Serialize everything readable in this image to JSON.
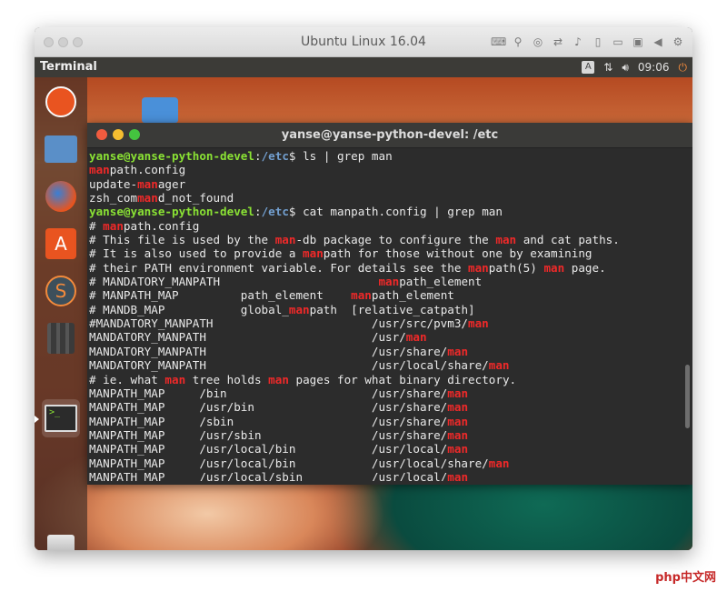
{
  "vm": {
    "title": "Ubuntu Linux 16.04",
    "toolbar_icons": [
      "keyboard-icon",
      "usb-icon",
      "disc-icon",
      "network-icon",
      "audio-icon",
      "phone-icon",
      "folder-icon",
      "display-icon",
      "back-icon",
      "gear-icon"
    ]
  },
  "panel": {
    "app_title": "Terminal",
    "keyboard_indicator": "A",
    "time": "09:06"
  },
  "launcher": {
    "items": [
      "ubuntu-dash-icon",
      "files-icon",
      "firefox-icon",
      "software-center-icon",
      "sublime-text-icon",
      "settings-icon",
      "terminal-icon",
      "trash-icon"
    ]
  },
  "terminal": {
    "title": "yanse@yanse-python-devel: /etc",
    "lines": [
      [
        [
          "user",
          "yanse@yanse-python-devel"
        ],
        [
          "text",
          ":"
        ],
        [
          "path",
          "/etc"
        ],
        [
          "text",
          "$ ls | grep man"
        ]
      ],
      [
        [
          "hl",
          "man"
        ],
        [
          "text",
          "path.config"
        ]
      ],
      [
        [
          "text",
          "update-"
        ],
        [
          "hl",
          "man"
        ],
        [
          "text",
          "ager"
        ]
      ],
      [
        [
          "text",
          "zsh_com"
        ],
        [
          "hl",
          "man"
        ],
        [
          "text",
          "d_not_found"
        ]
      ],
      [
        [
          "user",
          "yanse@yanse-python-devel"
        ],
        [
          "text",
          ":"
        ],
        [
          "path",
          "/etc"
        ],
        [
          "text",
          "$ cat manpath.config | grep man"
        ]
      ],
      [
        [
          "text",
          "# "
        ],
        [
          "hl",
          "man"
        ],
        [
          "text",
          "path.config"
        ]
      ],
      [
        [
          "text",
          "# This file is used by the "
        ],
        [
          "hl",
          "man"
        ],
        [
          "text",
          "-db package to configure the "
        ],
        [
          "hl",
          "man"
        ],
        [
          "text",
          " and cat paths."
        ]
      ],
      [
        [
          "text",
          "# It is also used to provide a "
        ],
        [
          "hl",
          "man"
        ],
        [
          "text",
          "path for those without one by examining"
        ]
      ],
      [
        [
          "text",
          "# their PATH environment variable. For details see the "
        ],
        [
          "hl",
          "man"
        ],
        [
          "text",
          "path(5) "
        ],
        [
          "hl",
          "man"
        ],
        [
          "text",
          " page."
        ]
      ],
      [
        [
          "text",
          "# MANDATORY_MANPATH                       "
        ],
        [
          "hl",
          "man"
        ],
        [
          "text",
          "path_element"
        ]
      ],
      [
        [
          "text",
          "# MANPATH_MAP         path_element    "
        ],
        [
          "hl",
          "man"
        ],
        [
          "text",
          "path_element"
        ]
      ],
      [
        [
          "text",
          "# MANDB_MAP           global_"
        ],
        [
          "hl",
          "man"
        ],
        [
          "text",
          "path  [relative_catpath]"
        ]
      ],
      [
        [
          "text",
          "#MANDATORY_MANPATH                       /usr/src/pvm3/"
        ],
        [
          "hl",
          "man"
        ]
      ],
      [
        [
          "text",
          "MANDATORY_MANPATH                        /usr/"
        ],
        [
          "hl",
          "man"
        ]
      ],
      [
        [
          "text",
          "MANDATORY_MANPATH                        /usr/share/"
        ],
        [
          "hl",
          "man"
        ]
      ],
      [
        [
          "text",
          "MANDATORY_MANPATH                        /usr/local/share/"
        ],
        [
          "hl",
          "man"
        ]
      ],
      [
        [
          "text",
          "# ie. what "
        ],
        [
          "hl",
          "man"
        ],
        [
          "text",
          " tree holds "
        ],
        [
          "hl",
          "man"
        ],
        [
          "text",
          " pages for what binary directory."
        ]
      ],
      [
        [
          "text",
          "MANPATH_MAP     /bin                     /usr/share/"
        ],
        [
          "hl",
          "man"
        ]
      ],
      [
        [
          "text",
          "MANPATH_MAP     /usr/bin                 /usr/share/"
        ],
        [
          "hl",
          "man"
        ]
      ],
      [
        [
          "text",
          "MANPATH_MAP     /sbin                    /usr/share/"
        ],
        [
          "hl",
          "man"
        ]
      ],
      [
        [
          "text",
          "MANPATH_MAP     /usr/sbin                /usr/share/"
        ],
        [
          "hl",
          "man"
        ]
      ],
      [
        [
          "text",
          "MANPATH_MAP     /usr/local/bin           /usr/local/"
        ],
        [
          "hl",
          "man"
        ]
      ],
      [
        [
          "text",
          "MANPATH_MAP     /usr/local/bin           /usr/local/share/"
        ],
        [
          "hl",
          "man"
        ]
      ],
      [
        [
          "text",
          "MANPATH_MAP     /usr/local/sbin          /usr/local/"
        ],
        [
          "hl",
          "man"
        ]
      ]
    ]
  },
  "watermark": "php中文网",
  "colors": {
    "prompt_user": "#8ae234",
    "prompt_path": "#729fcf",
    "highlight": "#ef2929",
    "close_button": "#f05b3f",
    "minimize_button": "#f5bd30",
    "maximize_button": "#44c43f"
  }
}
